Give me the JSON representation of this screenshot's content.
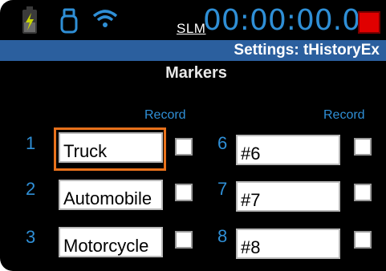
{
  "status_bar": {
    "battery_icon": "battery-charging-icon",
    "usb_icon": "usb-icon",
    "wifi_icon": "wifi-icon",
    "slm_label": "SLM",
    "timer": "00:00:00.0",
    "stop_icon": "stop-record-icon",
    "colors": {
      "accent": "#2f8fd6",
      "stop": "#e00000",
      "title_bar": "#2b5f9e",
      "focus": "#e8711b"
    }
  },
  "title": "Settings: tHistoryEx",
  "section_label": "Markers",
  "record_header": "Record",
  "markers_left": [
    {
      "number": "1",
      "name": "Truck",
      "record": false
    },
    {
      "number": "2",
      "name": "Automobile",
      "record": false
    },
    {
      "number": "3",
      "name": "Motorcycle",
      "record": false
    }
  ],
  "markers_right": [
    {
      "number": "6",
      "name": "#6",
      "record": false
    },
    {
      "number": "7",
      "name": "#7",
      "record": false
    },
    {
      "number": "8",
      "name": "#8",
      "record": false
    }
  ]
}
